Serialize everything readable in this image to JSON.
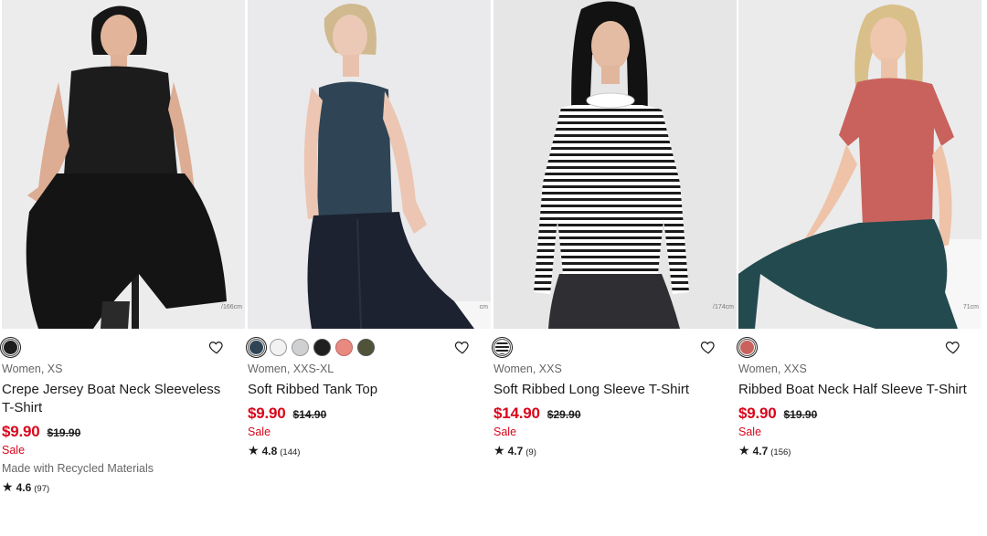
{
  "products": [
    {
      "category_size": "Women, XS",
      "name": "Crepe Jersey Boat Neck Sleeveless T-Shirt",
      "price": "$9.90",
      "original_price": "$19.90",
      "sale_label": "Sale",
      "extra_label": "Made with Recycled Materials",
      "rating": "4.6",
      "review_count": "(97)",
      "model_height": "/166cm",
      "swatches": [
        "#1f1f1f"
      ],
      "backdrop": "#e9e9ea"
    },
    {
      "category_size": "Women, XXS-XL",
      "name": "Soft Ribbed Tank Top",
      "price": "$9.90",
      "original_price": "$14.90",
      "sale_label": "Sale",
      "rating": "4.8",
      "review_count": "(144)",
      "model_height": "cm",
      "swatches": [
        "#2f4556",
        "#f2f2f2",
        "#cfd0d2",
        "#1f1f1f",
        "#e98a80",
        "#505338"
      ],
      "backdrop": "#e7e8ea"
    },
    {
      "category_size": "Women, XXS",
      "name": "Soft Ribbed Long Sleeve T-Shirt",
      "price": "$14.90",
      "original_price": "$29.90",
      "sale_label": "Sale",
      "rating": "4.7",
      "review_count": "(9)",
      "model_height": "/174cm",
      "swatches": [
        "stripe"
      ],
      "backdrop": "#e4e4e5"
    },
    {
      "category_size": "Women, XXS",
      "name": "Ribbed Boat Neck Half Sleeve T-Shirt",
      "price": "$9.90",
      "original_price": "$19.90",
      "sale_label": "Sale",
      "rating": "4.7",
      "review_count": "(156)",
      "model_height": "71cm",
      "swatches": [
        "#c9625c"
      ],
      "backdrop": "#e8e9ea"
    }
  ]
}
